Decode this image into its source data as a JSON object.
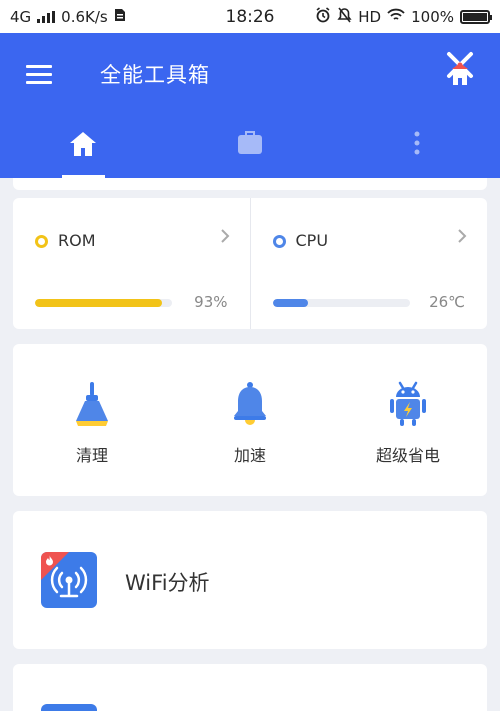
{
  "status_bar": {
    "network": "4G",
    "speed": "0.6K/s",
    "time": "18:26",
    "hd": "HD",
    "battery": "100%"
  },
  "app_bar": {
    "title": "全能工具箱"
  },
  "tabs": [
    {
      "icon": "home-icon",
      "active": true
    },
    {
      "icon": "briefcase-icon",
      "active": false
    },
    {
      "icon": "more-vertical-icon",
      "active": false
    }
  ],
  "stats": {
    "rom": {
      "label": "ROM",
      "value": "93%",
      "progress": 0.93,
      "color": "#f2c318"
    },
    "cpu": {
      "label": "CPU",
      "value": "26℃",
      "progress": 0.26,
      "color": "#4f86e8"
    }
  },
  "tools": [
    {
      "label": "清理",
      "icon": "broom-icon"
    },
    {
      "label": "加速",
      "icon": "bell-icon"
    },
    {
      "label": "超级省电",
      "icon": "android-battery-icon"
    }
  ],
  "features": [
    {
      "label": "WiFi分析",
      "icon": "wifi-analysis-icon",
      "badge_icon": "hot-flame-icon"
    }
  ],
  "colors": {
    "primary": "#3b66f0",
    "icon_blue": "#3d7be8",
    "badge_red": "#ef5350"
  }
}
